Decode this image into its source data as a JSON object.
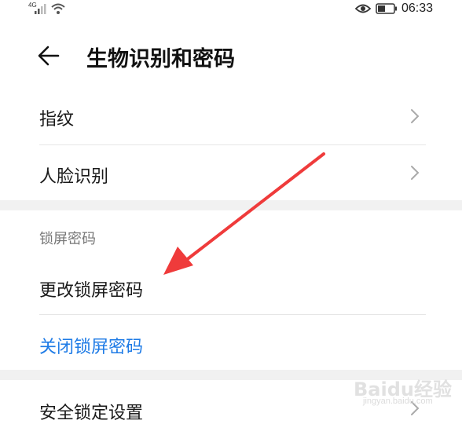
{
  "status_bar": {
    "network": "4G",
    "time": "06:33",
    "icons": [
      "signal-icon",
      "wifi-icon",
      "eye-icon",
      "battery-icon"
    ]
  },
  "header": {
    "back_icon": "arrow-left-icon",
    "title": "生物识别和密码"
  },
  "items": {
    "fingerprint": "指纹",
    "face_recognition": "人脸识别",
    "section_lock_screen": "锁屏密码",
    "change_lock_password": "更改锁屏密码",
    "disable_lock_password": "关闭锁屏密码",
    "security_lock_settings": "安全锁定设置"
  },
  "watermark": {
    "logo_text": "Baidu经验",
    "url": "jingyan.baidu.com"
  },
  "colors": {
    "link_blue": "#1e7be6",
    "annotation_arrow": "#ef3b3b",
    "section_gap": "#f1f1f1"
  }
}
